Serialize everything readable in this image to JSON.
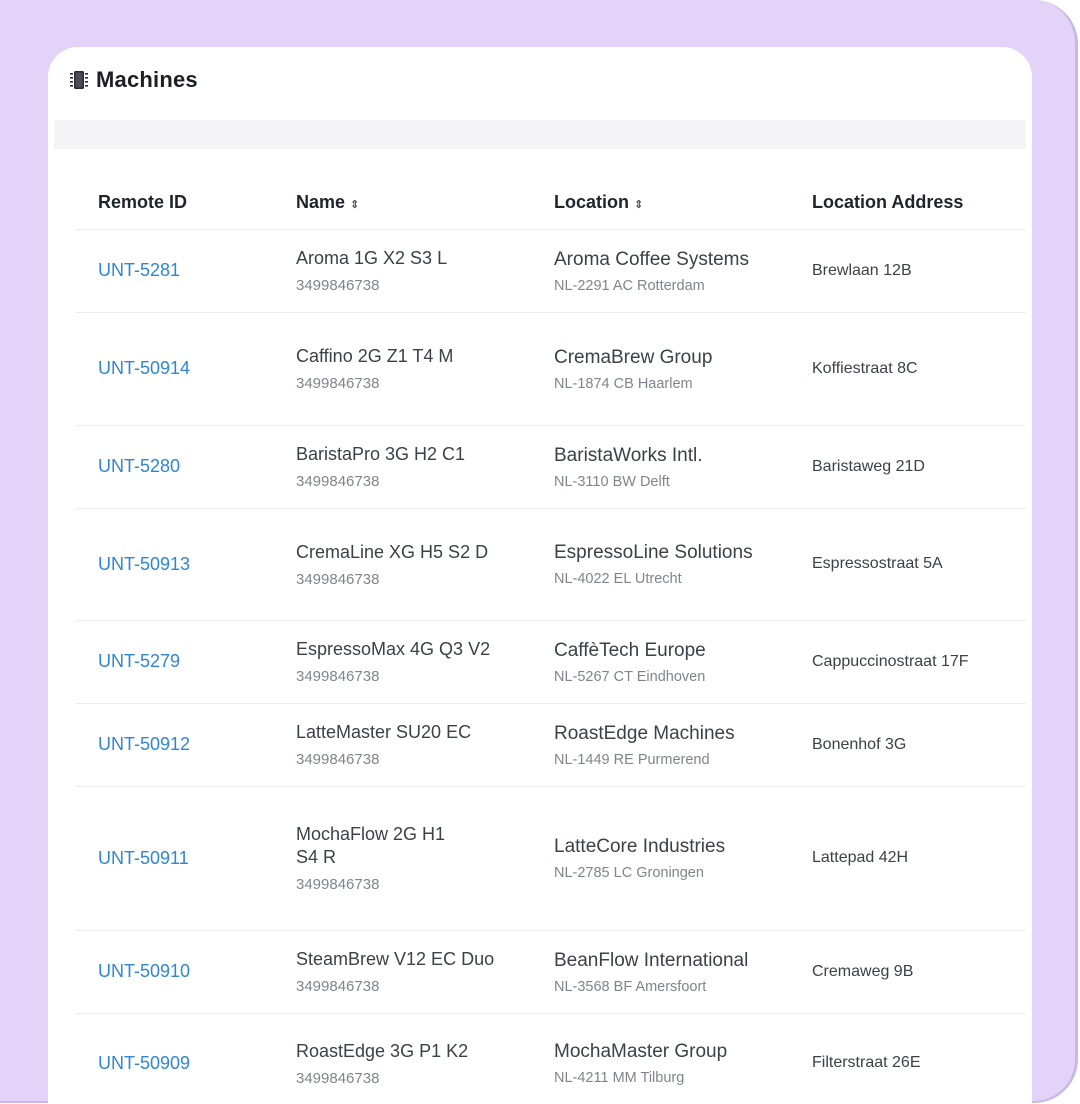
{
  "card": {
    "title": "Machines",
    "icon": "chip-icon"
  },
  "table": {
    "columns": [
      {
        "label": "Remote ID",
        "sortable": false
      },
      {
        "label": "Name",
        "sortable": true
      },
      {
        "label": "Location",
        "sortable": true
      },
      {
        "label": "Location Address",
        "sortable": false
      }
    ],
    "sort_glyph": "⇕",
    "rows": [
      {
        "remote_id": "UNT-5281",
        "name": "Aroma 1G X2 S3 L",
        "serial": "3499846738",
        "location": "Aroma Coffee Systems",
        "location_sub": "NL-2291 AC Rotterdam",
        "address": "Brewlaan 12B"
      },
      {
        "remote_id": "UNT-50914",
        "name": "Caffino 2G Z1 T4 M",
        "serial": "3499846738",
        "location": "CremaBrew Group",
        "location_sub": "NL-1874 CB Haarlem",
        "address": "Koffiestraat 8C"
      },
      {
        "remote_id": "UNT-5280",
        "name": "BaristaPro 3G H2 C1",
        "serial": "3499846738",
        "location": "BaristaWorks Intl.",
        "location_sub": "NL-3110 BW Delft",
        "address": "Baristaweg 21D"
      },
      {
        "remote_id": "UNT-50913",
        "name": "CremaLine XG H5 S2 D",
        "serial": "3499846738",
        "location": "EspressoLine Solutions",
        "location_sub": "NL-4022 EL Utrecht",
        "address": "Espressostraat 5A"
      },
      {
        "remote_id": "UNT-5279",
        "name": "EspressoMax 4G Q3 V2",
        "serial": "3499846738",
        "location": "CaffèTech Europe",
        "location_sub": "NL-5267 CT Eindhoven",
        "address": "Cappuccinostraat 17F"
      },
      {
        "remote_id": "UNT-50912",
        "name": "LatteMaster SU20 EC",
        "serial": "3499846738",
        "location": "RoastEdge Machines",
        "location_sub": "NL-1449 RE Purmerend",
        "address": "Bonenhof 3G"
      },
      {
        "remote_id": "UNT-50911",
        "name": "MochaFlow 2G H1 S4 R",
        "serial": "3499846738",
        "location": "LatteCore Industries",
        "location_sub": "NL-2785 LC Groningen",
        "address": "Lattepad 42H"
      },
      {
        "remote_id": "UNT-50910",
        "name": "SteamBrew V12 EC Duo",
        "serial": "3499846738",
        "location": "BeanFlow International",
        "location_sub": "NL-3568 BF Amersfoort",
        "address": "Cremaweg 9B"
      },
      {
        "remote_id": "UNT-50909",
        "name": "RoastEdge 3G P1 K2",
        "serial": "3499846738",
        "location": "MochaMaster Group",
        "location_sub": "NL-4211 MM Tilburg",
        "address": "Filterstraat 26E"
      }
    ]
  },
  "colors": {
    "background": "#e3d3f8",
    "link": "#2f86d4",
    "text": "#3c4048",
    "muted": "#80848c"
  }
}
